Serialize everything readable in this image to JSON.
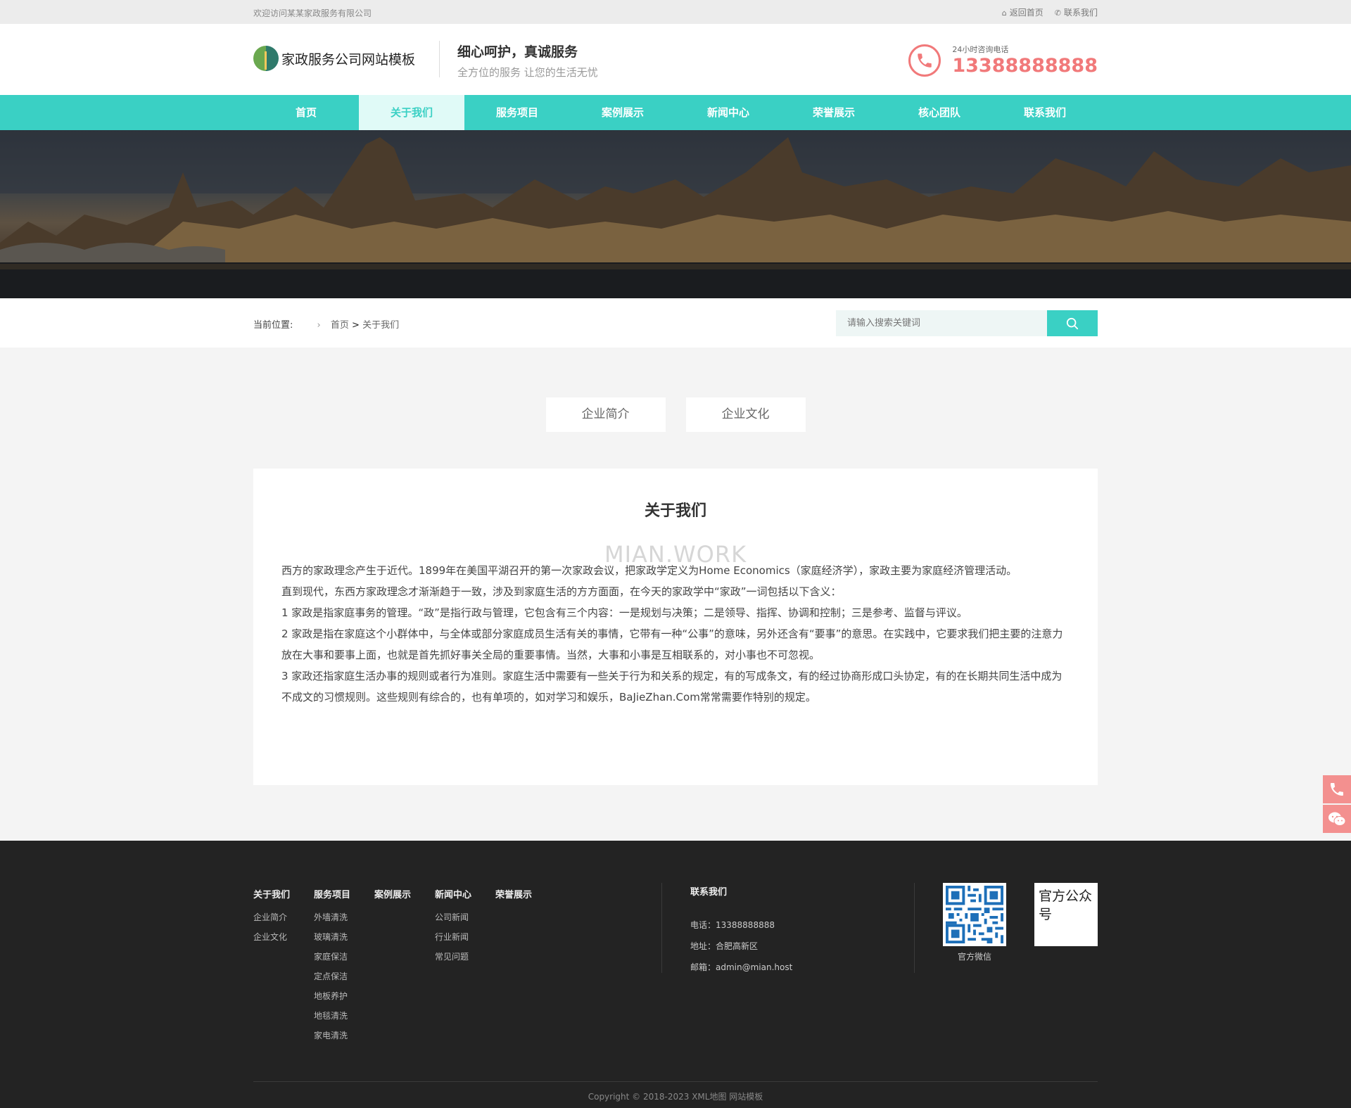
{
  "topbar": {
    "welcome": "欢迎访问某某家政服务有限公司",
    "home_link": "返回首页",
    "contact_link": "联系我们"
  },
  "header": {
    "logo_text": "家政服务公司网站模板",
    "slogan_title": "细心呵护，真诚服务",
    "slogan_sub": "全方位的服务 让您的生活无忧",
    "hotline_label": "24小时咨询电话",
    "hotline_number": "13388888888"
  },
  "nav": {
    "items": [
      {
        "label": "首页"
      },
      {
        "label": "关于我们"
      },
      {
        "label": "服务项目"
      },
      {
        "label": "案例展示"
      },
      {
        "label": "新闻中心"
      },
      {
        "label": "荣誉展示"
      },
      {
        "label": "核心团队"
      },
      {
        "label": "联系我们"
      }
    ],
    "active": "关于我们"
  },
  "breadcrumb": {
    "label": "当前位置:",
    "home": "首页",
    "separator": ">",
    "current": "关于我们"
  },
  "search": {
    "placeholder": "请输入搜索关键词",
    "icon": "search-icon"
  },
  "tabs": [
    {
      "label": "企业简介"
    },
    {
      "label": "企业文化"
    }
  ],
  "article": {
    "title": "关于我们",
    "watermark": "MIAN.WORK",
    "paragraphs": [
      "西方的家政理念产生于近代。1899年在美国平湖召开的第一次家政会议，把家政学定义为Home Economics（家庭经济学），家政主要为家庭经济管理活动。",
      "直到现代，东西方家政理念才渐渐趋于一致，涉及到家庭生活的方方面面，在今天的家政学中“家政”一词包括以下含义：",
      "1 家政是指家庭事务的管理。“政”是指行政与管理，它包含有三个内容：一是规划与决策；二是领导、指挥、协调和控制；三是参考、监督与评议。",
      "2 家政是指在家庭这个小群体中，与全体或部分家庭成员生活有关的事情，它带有一种“公事”的意味，另外还含有“要事”的意思。在实践中，它要求我们把主要的注意力放在大事和要事上面，也就是首先抓好事关全局的重要事情。当然，大事和小事是互相联系的，对小事也不可忽视。",
      "3 家政还指家庭生活办事的规则或者行为准则。家庭生活中需要有一些关于行为和关系的规定，有的写成条文，有的经过协商形成口头协定，有的在长期共同生活中成为不成文的习惯规则。这些规则有综合的，也有单项的，如对学习和娱乐，BaJieZhan.Com常常需要作特别的规定。"
    ]
  },
  "footer": {
    "columns": [
      {
        "title": "关于我们",
        "items": [
          "企业简介",
          "企业文化"
        ]
      },
      {
        "title": "服务项目",
        "items": [
          "外墙清洗",
          "玻璃清洗",
          "家庭保洁",
          "定点保洁",
          "地板养护",
          "地毯清洗",
          "家电清洗"
        ]
      },
      {
        "title": "案例展示",
        "items": []
      },
      {
        "title": "新闻中心",
        "items": [
          "公司新闻",
          "行业新闻",
          "常见问题"
        ]
      },
      {
        "title": "荣誉展示",
        "items": []
      }
    ],
    "contact": {
      "title": "联系我们",
      "phone": "电话：13388888888",
      "address": "地址：合肥高新区",
      "email": "邮箱：admin@mian.host"
    },
    "qr_wechat_caption": "官方微信",
    "qr_public_alt": "官方公众号",
    "copyright": "Copyright © 2018-2023 XML地图 网站模板"
  },
  "colors": {
    "accent": "#3ad0c4",
    "hotline": "#f1797a",
    "footer_bg": "#232323"
  }
}
